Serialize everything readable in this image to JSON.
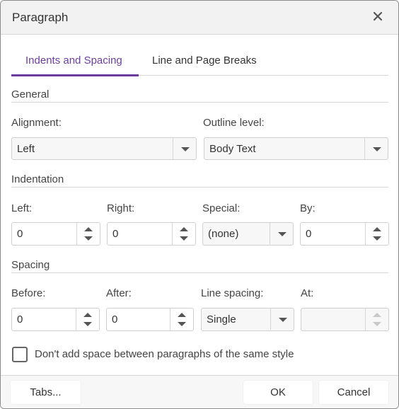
{
  "dialog": {
    "title": "Paragraph",
    "close_icon": "close-x-icon"
  },
  "tabs": [
    {
      "label": "Indents and Spacing",
      "active": true
    },
    {
      "label": "Line and Page Breaks",
      "active": false
    }
  ],
  "colors": {
    "accent": "#6b3b9e"
  },
  "general": {
    "section_label": "General",
    "alignment": {
      "label": "Alignment:",
      "value": "Left"
    },
    "outline_level": {
      "label": "Outline level:",
      "value": "Body Text"
    }
  },
  "indentation": {
    "section_label": "Indentation",
    "left": {
      "label": "Left:",
      "value": "0"
    },
    "right": {
      "label": "Right:",
      "value": "0"
    },
    "special": {
      "label": "Special:",
      "value": "(none)"
    },
    "by": {
      "label": "By:",
      "value": "0"
    }
  },
  "spacing": {
    "section_label": "Spacing",
    "before": {
      "label": "Before:",
      "value": "0"
    },
    "after": {
      "label": "After:",
      "value": "0"
    },
    "line_spacing": {
      "label": "Line spacing:",
      "value": "Single"
    },
    "at": {
      "label": "At:",
      "value": ""
    }
  },
  "options": {
    "dont_add_space": {
      "label": "Don't add space between paragraphs of the same style",
      "checked": false
    }
  },
  "footer": {
    "tabs_button": "Tabs...",
    "ok_button": "OK",
    "cancel_button": "Cancel"
  }
}
